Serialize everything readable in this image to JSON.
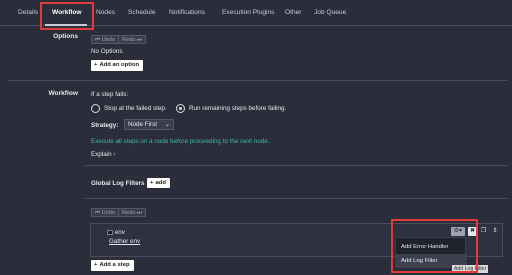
{
  "tabs": [
    {
      "label": "Details"
    },
    {
      "label": "Workflow",
      "active": true
    },
    {
      "label": "Nodes"
    },
    {
      "label": "Schedule"
    },
    {
      "label": "Notifications"
    },
    {
      "label": "Execution Plugins"
    },
    {
      "label": "Other"
    },
    {
      "label": "Job Queue"
    }
  ],
  "options_section": {
    "label": "Options",
    "undo": "Undo",
    "redo": "Redo",
    "empty_text": "No Options",
    "add_button": "Add an option"
  },
  "workflow_section": {
    "label": "Workflow",
    "if_fails_label": "If a step fails:",
    "radio_stop": "Stop at the failed step.",
    "radio_run": "Run remaining steps before failing.",
    "strategy_label": "Strategy:",
    "strategy_value": "Node First",
    "strategy_help": "Execute all steps on a node before proceeding to the next node.",
    "explain_link": "Explain"
  },
  "global_log_filters": {
    "label": "Global Log Filters",
    "add_button": "add"
  },
  "steps": {
    "undo": "Undo",
    "redo": "Redo",
    "items": [
      {
        "number": "1.",
        "title": "env",
        "subtitle": "Gather env"
      }
    ],
    "add_button": "Add a step"
  },
  "step_menu": {
    "items": [
      "Add Error Handler",
      "Add Log Filter"
    ],
    "tooltip": "Add Log Filter"
  },
  "colors": {
    "background": "#2b2d3a",
    "highlight": "#e33a3a",
    "teal": "#3fb6a8"
  }
}
